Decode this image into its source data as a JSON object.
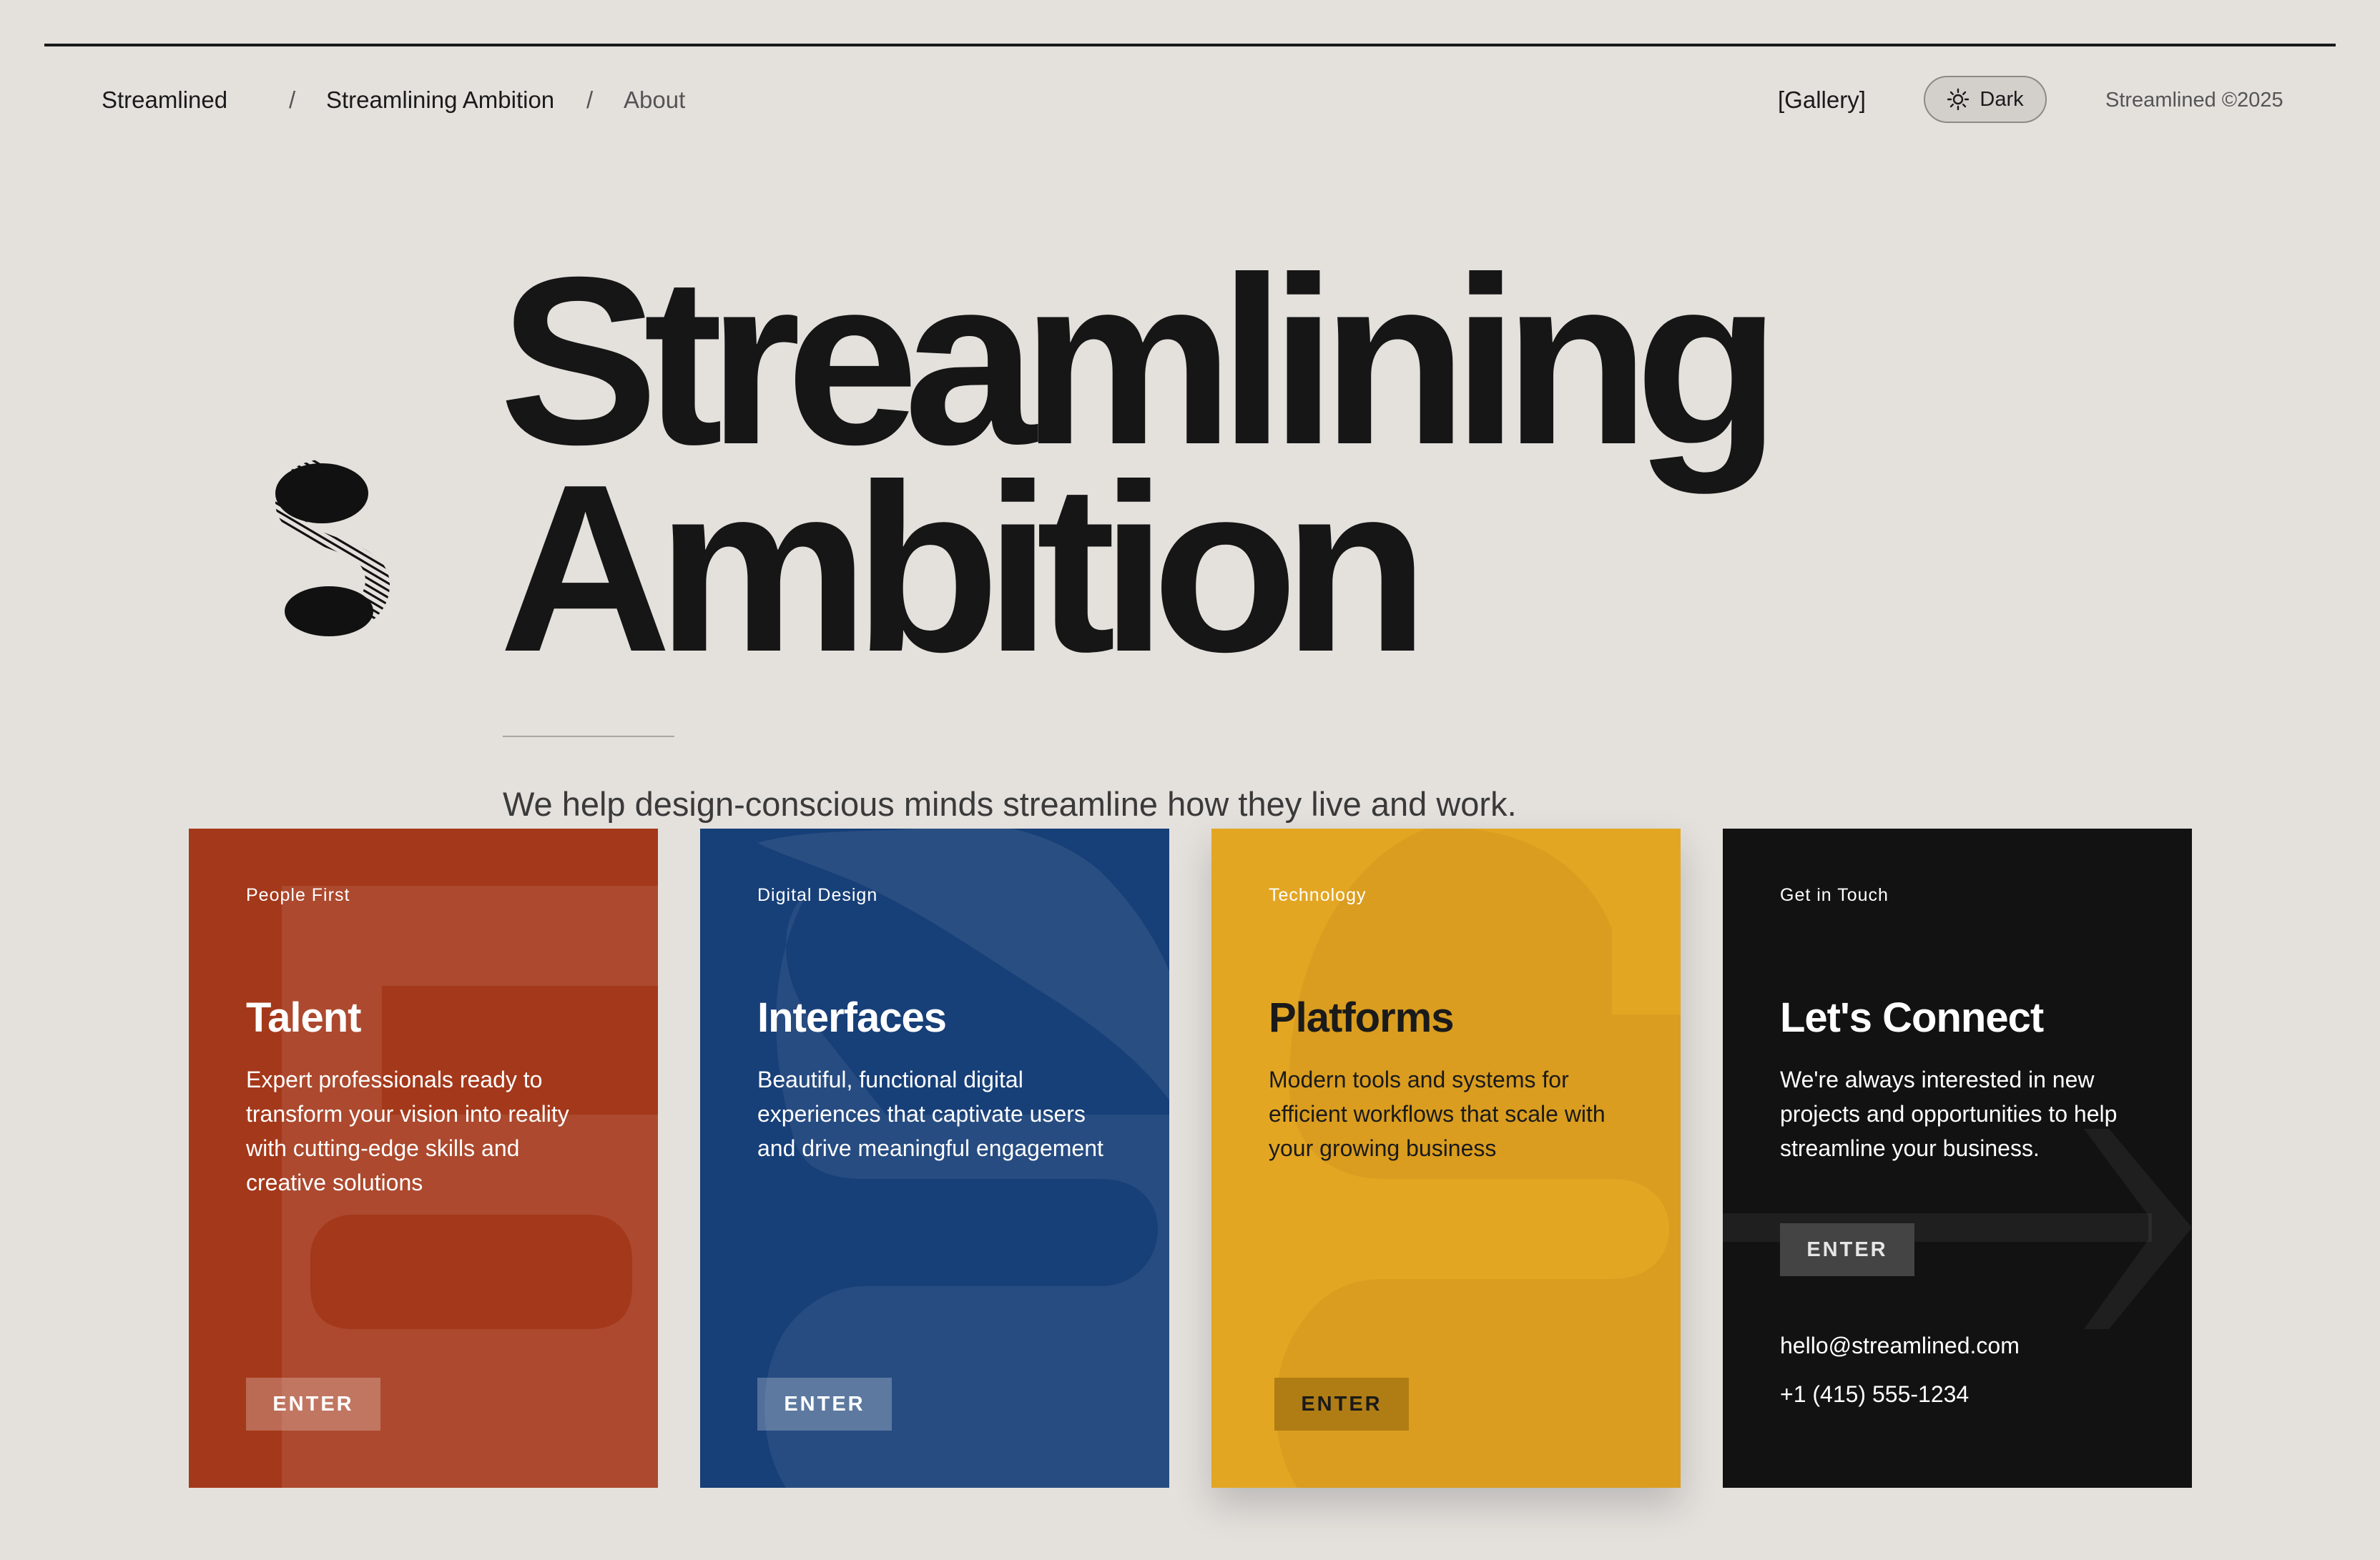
{
  "header": {
    "brand": "Streamlined",
    "breadcrumb_separator": "/",
    "breadcrumb_current": "Streamlining Ambition",
    "breadcrumb_about": "About",
    "gallery_link": "[Gallery]",
    "theme_toggle_label": "Dark",
    "theme_toggle_icon": "sun-icon",
    "copyright": "Streamlined ©2025"
  },
  "hero": {
    "logo_icon": "streamlined-s-logo-icon",
    "title_line1": "Streamlining",
    "title_line2": "Ambition",
    "tagline": "We help design-conscious minds streamline how they live and work."
  },
  "cards": [
    {
      "kicker": "People First",
      "title": "Talent",
      "description": "Expert professionals ready to transform your vision into reality with cutting-edge skills and creative solutions",
      "button": "ENTER",
      "color": "#a4381a",
      "background_glyph": "S"
    },
    {
      "kicker": "Digital Design",
      "title": "Interfaces",
      "description": "Beautiful, functional digital experiences that captivate users and drive meaningful engagement",
      "button": "ENTER",
      "color": "#173f78",
      "background_glyph": "S"
    },
    {
      "kicker": "Technology",
      "title": "Platforms",
      "description": "Modern tools and systems for efficient workflows that scale with your growing business",
      "button": "ENTER",
      "color": "#e3a623",
      "background_glyph": "S"
    },
    {
      "kicker": "Get in Touch",
      "title": "Let's Connect",
      "description": "We're always interested in new projects and opportunities to help streamline your business.",
      "button": "ENTER",
      "color": "#121212",
      "background_icon": "arrow-right-icon",
      "email": "hello@streamlined.com",
      "phone": "+1 (415) 555-1234"
    }
  ]
}
